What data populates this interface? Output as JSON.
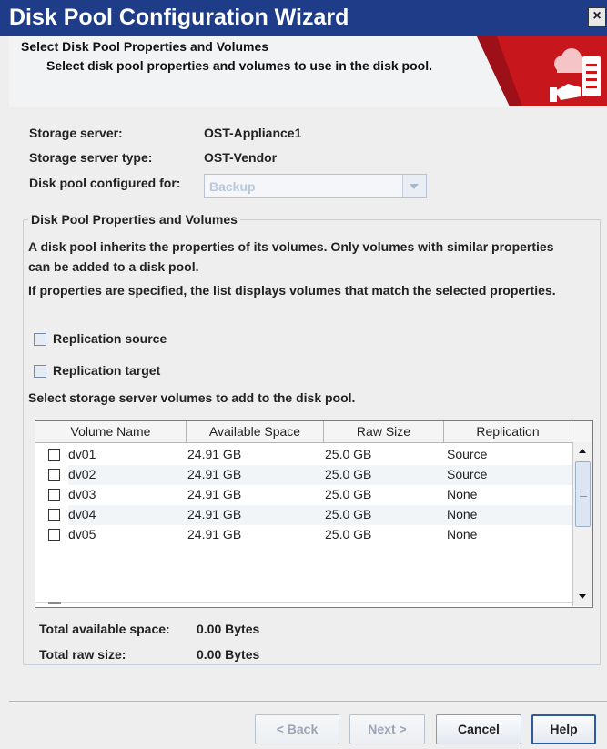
{
  "window": {
    "title": "Disk Pool Configuration Wizard",
    "close_glyph": "×"
  },
  "header": {
    "title": "Select Disk Pool Properties and Volumes",
    "subtitle": "Select disk pool properties and volumes to use in the disk pool.",
    "icon": "cloud-storage-icon",
    "accent_color": "#c8161d"
  },
  "info": {
    "storage_server_label": "Storage server:",
    "storage_server_value": "OST-Appliance1",
    "storage_server_type_label": "Storage server type:",
    "storage_server_type_value": "OST-Vendor",
    "configured_for_label": "Disk pool configured for:",
    "configured_for_value": "Backup"
  },
  "group": {
    "title": "Disk Pool Properties and Volumes",
    "para1": "A disk pool inherits the properties of its volumes. Only volumes with similar properties can be added to a disk pool.",
    "para2": "If properties are specified, the list displays volumes that match the selected properties.",
    "replication_source_label": "Replication source",
    "replication_target_label": "Replication target",
    "select_label": "Select storage server volumes to add to the disk pool."
  },
  "table": {
    "columns": [
      "Volume Name",
      "Available Space",
      "Raw Size",
      "Replication"
    ],
    "rows": [
      {
        "name": "dv01",
        "available": "24.91 GB",
        "raw": "25.0 GB",
        "replication": "Source"
      },
      {
        "name": "dv02",
        "available": "24.91 GB",
        "raw": "25.0 GB",
        "replication": "Source"
      },
      {
        "name": "dv03",
        "available": "24.91 GB",
        "raw": "25.0 GB",
        "replication": "None"
      },
      {
        "name": "dv04",
        "available": "24.91 GB",
        "raw": "25.0 GB",
        "replication": "None"
      },
      {
        "name": "dv05",
        "available": "24.91 GB",
        "raw": "25.0 GB",
        "replication": "None"
      }
    ]
  },
  "totals": {
    "available_label": "Total available space:",
    "available_value": "0.00 Bytes",
    "raw_label": "Total raw size:",
    "raw_value": "0.00 Bytes"
  },
  "buttons": {
    "back": "< Back",
    "next": "Next >",
    "cancel": "Cancel",
    "help": "Help"
  }
}
